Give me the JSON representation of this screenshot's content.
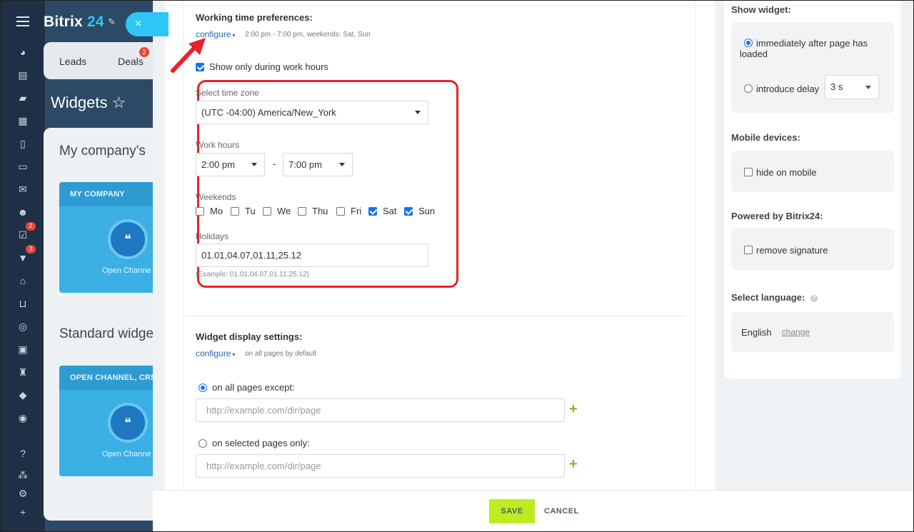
{
  "app": {
    "logo_text": "Bitrix",
    "logo_num": "24",
    "close_icon": "×",
    "sidebar_badges": {
      "tasks": "2",
      "filter": "3"
    }
  },
  "background": {
    "tabs": [
      {
        "label": "Leads"
      },
      {
        "label": "Deals",
        "badge": "2"
      }
    ],
    "page_title": "Widgets ☆",
    "section1": "My company's",
    "card1_header": "MY COMPANY",
    "card1_text": "Open Channe",
    "section2": "Standard widge",
    "card2_header": "OPEN CHANNEL, CRM",
    "card2_text": "Open Channe"
  },
  "working_time": {
    "title": "Working time preferences:",
    "configure_label": "configure",
    "summary": "2:00 pm - 7:00 pm, weekends: Sat, Sun",
    "show_only_label": "Show only during work hours",
    "show_only_checked": true,
    "timezone_label": "Select time zone",
    "timezone_value": "(UTC -04:00) America/New_York",
    "work_hours_label": "Work hours",
    "work_from": "2:00 pm",
    "work_to": "7:00 pm",
    "dash": "-",
    "weekends_label": "Weekends",
    "days": [
      {
        "label": "Mo",
        "checked": false
      },
      {
        "label": "Tu",
        "checked": false
      },
      {
        "label": "We",
        "checked": false
      },
      {
        "label": "Thu",
        "checked": false
      },
      {
        "label": "Fri",
        "checked": false
      },
      {
        "label": "Sat",
        "checked": true
      },
      {
        "label": "Sun",
        "checked": true
      }
    ],
    "holidays_label": "Holidays",
    "holidays_value": "01.01,04.07,01.11,25.12",
    "holidays_hint": "(Example: 01.01,04.07,01.11,25.12)"
  },
  "display": {
    "title": "Widget display settings:",
    "configure_label": "configure",
    "summary": "on all pages by default",
    "option_all_label": "on all pages except:",
    "option_selected_label": "on selected pages only:",
    "url_placeholder": "http://example.com/dir/page",
    "plus": "+"
  },
  "right": {
    "show_widget_title": "Show widget:",
    "immediately_label": "immediately after page has loaded",
    "delay_label": "introduce delay",
    "delay_value": "3 s",
    "mobile_title": "Mobile devices:",
    "hide_mobile_label": "hide on mobile",
    "powered_title": "Powered by Bitrix24:",
    "remove_signature_label": "remove signature",
    "language_title": "Select language:",
    "help_icon": "?",
    "language_value": "English",
    "change_label": "change"
  },
  "footer": {
    "save_label": "SAVE",
    "cancel_label": "CANCEL"
  },
  "colors": {
    "accent_blue": "#2fc6f6",
    "save_green": "#bbed21",
    "highlight_red": "#e8212a",
    "link_blue": "#2066b0"
  }
}
